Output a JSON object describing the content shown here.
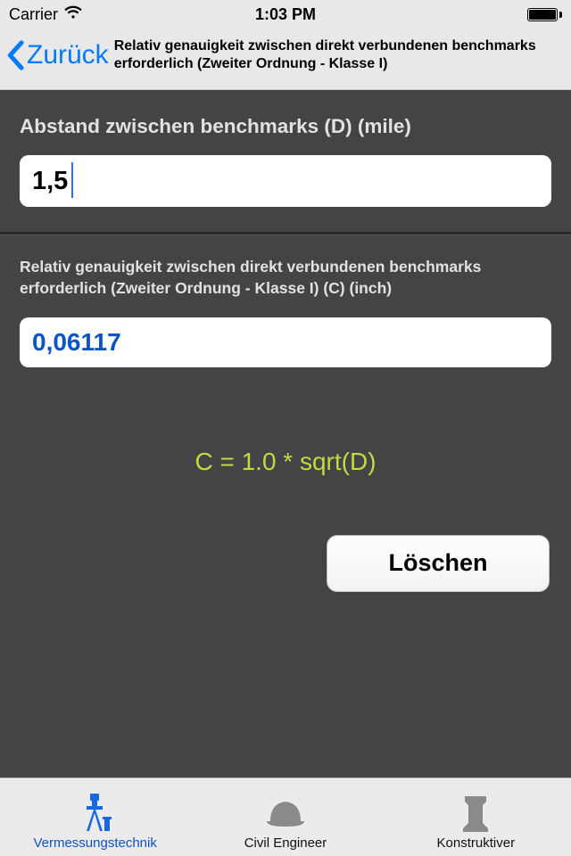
{
  "status": {
    "carrier": "Carrier",
    "time": "1:03 PM"
  },
  "nav": {
    "back_label": "Zurück",
    "title": "Relativ genauigkeit zwischen direkt verbundenen benchmarks erforderlich (Zweiter Ordnung - Klasse I)"
  },
  "input": {
    "label": "Abstand zwischen benchmarks (D) (mile)",
    "value": "1,5"
  },
  "output": {
    "label": "Relativ genauigkeit zwischen direkt verbundenen benchmarks erforderlich (Zweiter Ordnung - Klasse I) (C) (inch)",
    "value": "0,06117"
  },
  "formula": "C = 1.0 * sqrt(D)",
  "buttons": {
    "clear": "Löschen"
  },
  "tabs": {
    "survey": "Vermessungstechnik",
    "civil": "Civil Engineer",
    "construct": "Konstruktiver"
  }
}
